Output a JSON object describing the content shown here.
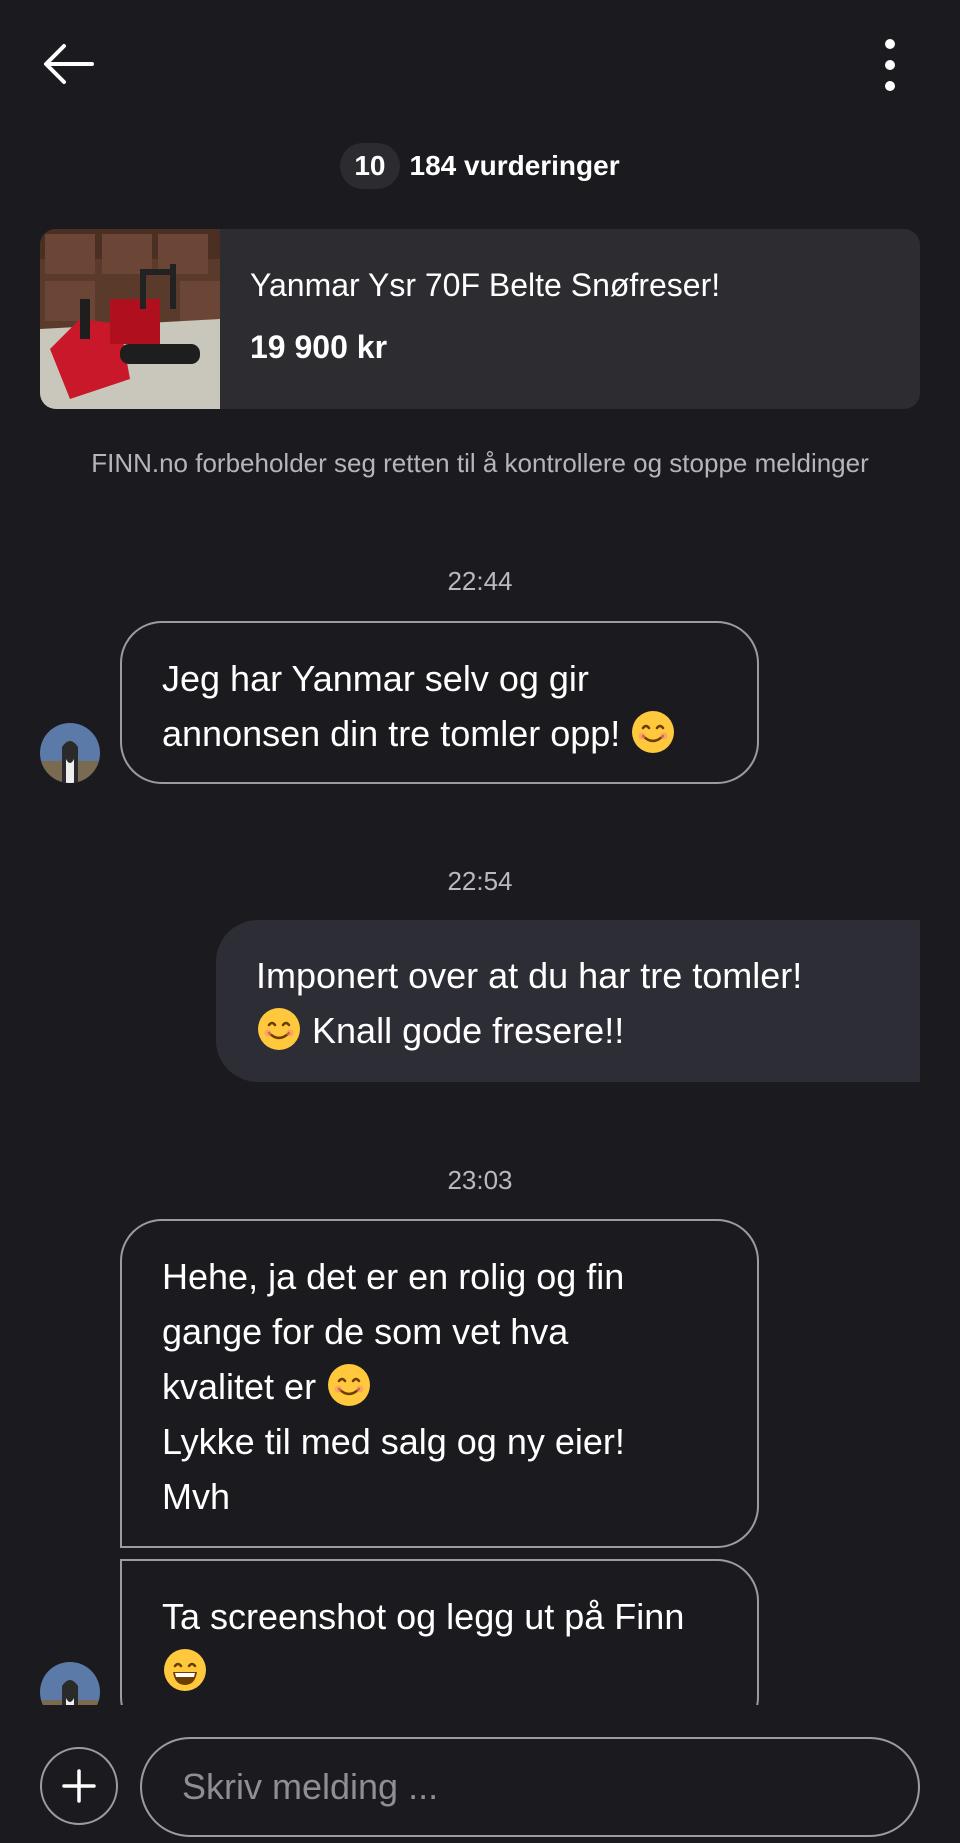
{
  "header": {
    "back_icon": "arrow-left-icon",
    "menu_icon": "more-vertical-icon",
    "rating_score": "10",
    "rating_count": "184 vurderinger"
  },
  "ad": {
    "title": "Yanmar Ysr 70F Belte Snøfreser!",
    "price": "19 900 kr",
    "thumbnail": "snowblower-photo"
  },
  "notice": "FINN.no forbeholder seg retten til å kontrollere og stoppe meldinger",
  "messages": [
    {
      "time": "22:44",
      "direction": "incoming",
      "lines": [
        "Jeg har Yanmar selv og gir",
        "annonsen din tre tomler opp!"
      ],
      "emoji": "smiling-face-icon"
    },
    {
      "time": "22:54",
      "direction": "outgoing",
      "lines": [
        "Imponert over at du har tre tomler!",
        "Knall gode fresere!!"
      ],
      "emoji": "smiling-face-icon"
    },
    {
      "time": "23:03",
      "direction": "incoming",
      "lines": [
        "Hehe, ja det er en rolig og fin",
        "gange for de som vet hva",
        "kvalitet er",
        "Lykke til med salg og ny eier!",
        "Mvh"
      ],
      "emoji": "smiling-face-icon"
    },
    {
      "direction": "incoming",
      "lines": [
        "Ta screenshot og legg ut på Finn"
      ],
      "emoji": "grinning-face-icon"
    }
  ],
  "composer": {
    "add_icon": "plus-icon",
    "placeholder": "Skriv melding ..."
  },
  "colors": {
    "background": "#1b1b1f",
    "card": "#2c2c31",
    "outgoing_bubble": "#2d2d35",
    "bubble_border": "#9b9ba2",
    "muted_text": "#b5b5bb"
  }
}
